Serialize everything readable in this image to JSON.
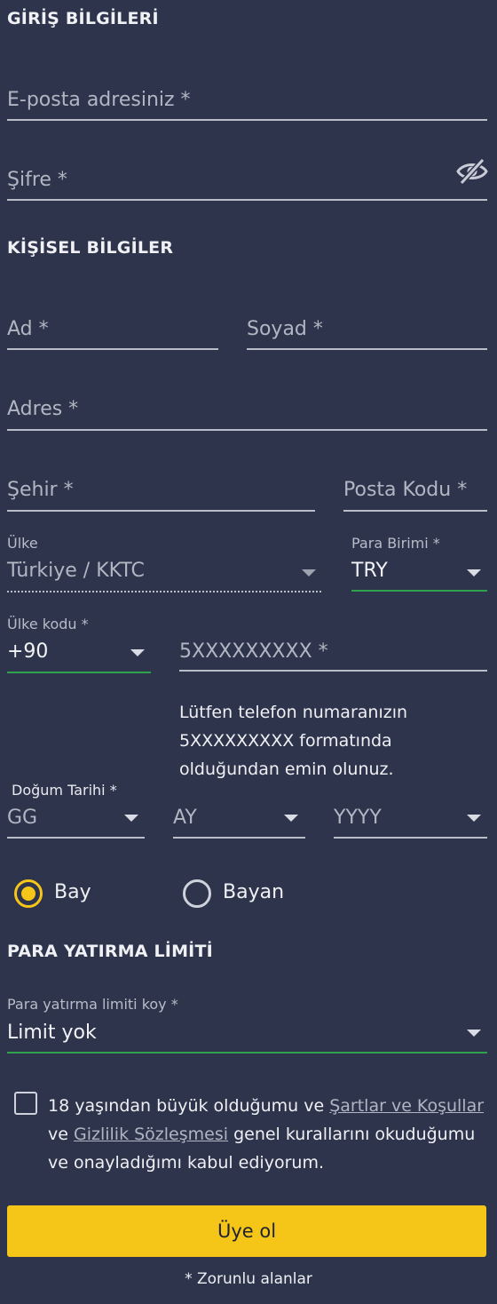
{
  "login_section": {
    "title": "GİRİŞ BİLGİLERİ",
    "email_placeholder": "E-posta adresiniz *",
    "password_placeholder": "Şifre *",
    "password_toggle_icon": "eye-slash-icon"
  },
  "personal_section": {
    "title": "KİŞİSEL BİLGİLER",
    "first_name_placeholder": "Ad *",
    "last_name_placeholder": "Soyad *",
    "address_placeholder": "Adres *",
    "city_placeholder": "Şehir *",
    "postal_code_placeholder": "Posta Kodu *",
    "country_label": "Ülke",
    "country_value": "Türkiye / KKTC",
    "currency_label": "Para Birimi *",
    "currency_value": "TRY",
    "country_code_label": "Ülke kodu *",
    "country_code_value": "+90",
    "phone_placeholder": "5XXXXXXXXX *",
    "phone_hint_lines": [
      "Lütfen telefon numaranızın",
      "5XXXXXXXXX formatında",
      "olduğundan emin olunuz."
    ],
    "birth_date_label": "Doğum Tarihi *",
    "birth_day": "GG",
    "birth_month": "AY",
    "birth_year": "YYYY",
    "gender_male": "Bay",
    "gender_female": "Bayan",
    "selected_gender": "Bay"
  },
  "deposit_section": {
    "title": "PARA YATIRMA LİMİTİ",
    "limit_label": "Para yatırma limiti koy *",
    "limit_value": "Limit yok"
  },
  "terms": {
    "text_1": "18 yaşından büyük olduğumu ve ",
    "link_terms": "Şartlar ve Koşullar",
    "text_2": "ve ",
    "link_privacy": "Gizlilik Sözleşmesi",
    "text_3": " genel kurallarını okuduğumu ve onayladığımı kabul ediyorum.",
    "checked": false
  },
  "submit_label": "Üye ol",
  "required_note": "* Zorunlu alanlar",
  "colors": {
    "background": "#2e344b",
    "accent": "#f5c518",
    "active_underline": "#2fa14d"
  }
}
